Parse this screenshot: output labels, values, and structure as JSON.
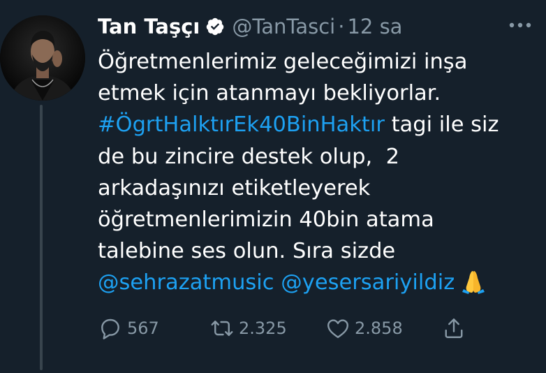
{
  "tweet": {
    "author_name": "Tan Taşçı",
    "author_handle": "@TanTasci",
    "separator": "·",
    "time": "12 sa",
    "text_lines": [
      [
        {
          "t": "Öğretmenlerimiz geleceğimizi inşa",
          "link": false
        }
      ],
      [
        {
          "t": "etmek için atanmayı bekliyorlar.",
          "link": false
        }
      ],
      [
        {
          "t": "#ÖgrtHalktırEk40BinHaktır",
          "link": true
        },
        {
          "t": " tagi ile siz",
          "link": false
        }
      ],
      [
        {
          "t": "de bu zincire destek olup,  2",
          "link": false
        }
      ],
      [
        {
          "t": "arkadaşınızı etiketleyerek",
          "link": false
        }
      ],
      [
        {
          "t": "öğretmenlerimizin 40bin atama",
          "link": false
        }
      ],
      [
        {
          "t": "talebine ses olun. Sıra sizde",
          "link": false
        }
      ],
      [
        {
          "t": "@sehrazatmusic",
          "link": true
        },
        {
          "t": " ",
          "link": false
        },
        {
          "t": "@yesersariyildiz",
          "link": true
        }
      ]
    ],
    "emoji": "folded-hands-emoji"
  },
  "actions": {
    "reply_count": "567",
    "retweet_count": "2.325",
    "like_count": "2.858"
  },
  "colors": {
    "background": "#15202b",
    "text": "#ffffff",
    "secondary": "#8899a6",
    "link": "#1da1f2",
    "verified": "#ffffff"
  }
}
